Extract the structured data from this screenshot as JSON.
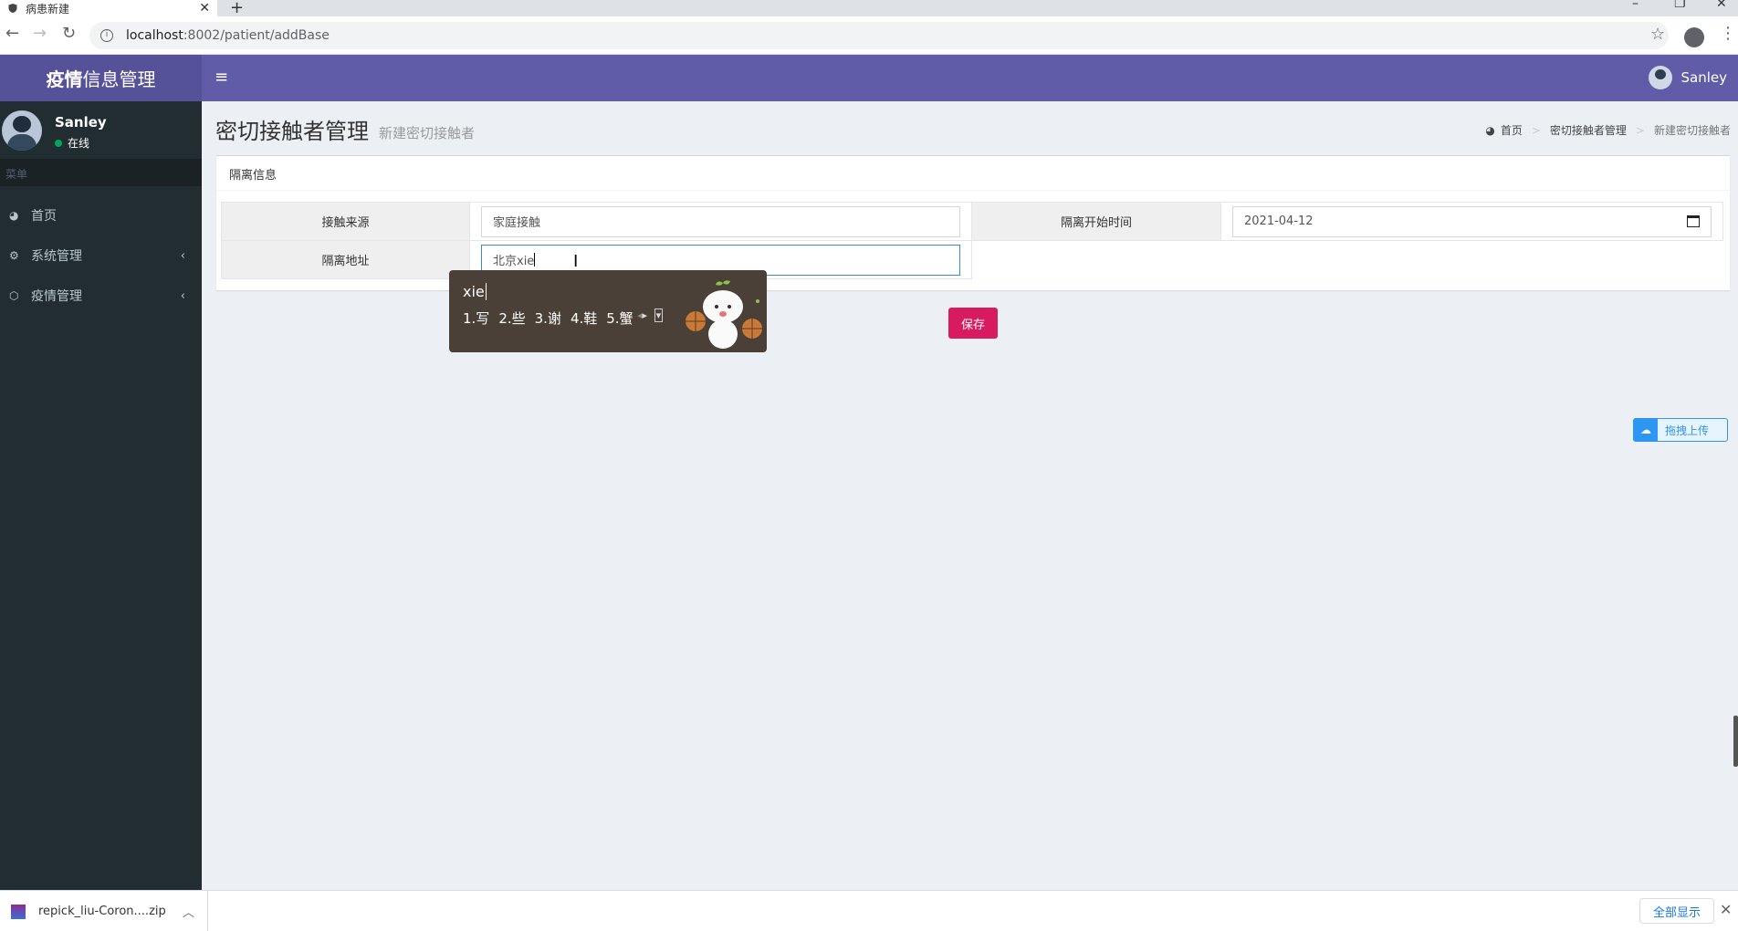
{
  "browser": {
    "tab_title": "病患新建",
    "url_host": "localhost",
    "url_path": ":8002/patient/addBase"
  },
  "header": {
    "logo_bold": "疫情",
    "logo_rest": "信息管理",
    "user_name": "Sanley"
  },
  "sidebar": {
    "user_name": "Sanley",
    "status": "在线",
    "menu_header": "菜单",
    "items": [
      {
        "label": "首页",
        "icon": "dashboard-icon"
      },
      {
        "label": "系统管理",
        "icon": "cogs-icon"
      },
      {
        "label": "疫情管理",
        "icon": "cube-icon"
      }
    ]
  },
  "page": {
    "title": "密切接触者管理",
    "subtitle": "新建密切接触者",
    "breadcrumb": [
      "首页",
      "密切接触者管理",
      "新建密切接触者"
    ]
  },
  "form": {
    "section_title": "隔离信息",
    "contact_source_label": "接触来源",
    "contact_source_value": "家庭接触",
    "start_time_label": "隔离开始时间",
    "start_time_value": "2021-04-12",
    "address_label": "隔离地址",
    "address_value": "北京xie",
    "save_label": "保存"
  },
  "ime": {
    "composition": "xie",
    "candidates": [
      "1.写",
      "2.些",
      "3.谢",
      "4.鞋",
      "5.蟹"
    ]
  },
  "upload_chip": {
    "label": "拖拽上传"
  },
  "downloads": {
    "file_name": "repick_liu-Coron....zip",
    "show_all": "全部显示"
  }
}
